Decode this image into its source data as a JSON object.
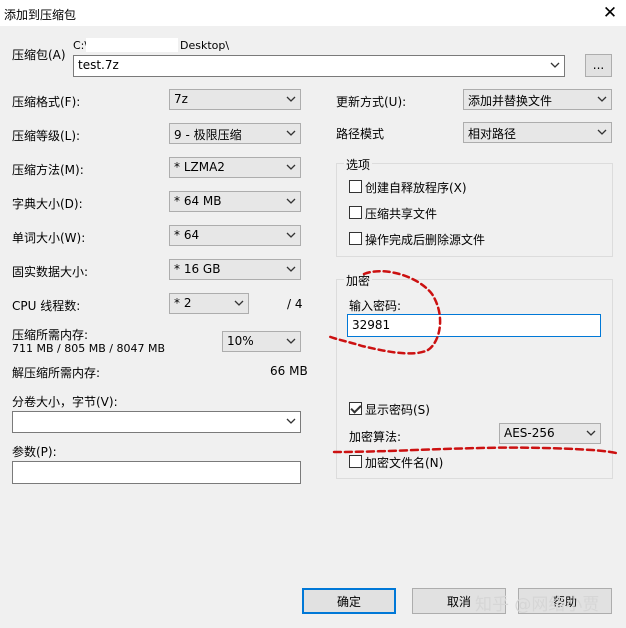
{
  "window": {
    "title": "添加到压缩包",
    "close_glyph": "✕"
  },
  "archive": {
    "label": "压缩包(A)",
    "path_prefix": "C:\\",
    "path_suffix": "Desktop\\",
    "filename": "test.7z",
    "browse_label": "..."
  },
  "left": {
    "format": {
      "label": "压缩格式(F):",
      "value": "7z"
    },
    "level": {
      "label": "压缩等级(L):",
      "value": "9 - 极限压缩"
    },
    "method": {
      "label": "压缩方法(M):",
      "value": "* LZMA2"
    },
    "dict": {
      "label": "字典大小(D):",
      "value": "* 64 MB"
    },
    "word": {
      "label": "单词大小(W):",
      "value": "* 64"
    },
    "solid": {
      "label": "固实数据大小:",
      "value": "* 16 GB"
    },
    "threads": {
      "label": "CPU 线程数:",
      "value": "* 2",
      "max": "/ 4"
    },
    "mem_compress": {
      "label": "压缩所需内存:",
      "detail": "711 MB / 805 MB / 8047 MB",
      "percent": "10%"
    },
    "mem_decompress": {
      "label": "解压缩所需内存:",
      "value": "66 MB"
    },
    "volume": {
      "label": "分卷大小，字节(V):",
      "value": ""
    },
    "params": {
      "label": "参数(P):",
      "value": ""
    }
  },
  "right": {
    "update": {
      "label": "更新方式(U):",
      "value": "添加并替换文件"
    },
    "pathmode": {
      "label": "路径模式",
      "value": "相对路径"
    },
    "options": {
      "title": "选项",
      "items": [
        {
          "label": "创建自释放程序(X)",
          "checked": false
        },
        {
          "label": "压缩共享文件",
          "checked": false
        },
        {
          "label": "操作完成后删除源文件",
          "checked": false
        }
      ]
    },
    "encryption": {
      "title": "加密",
      "password_label": "输入密码:",
      "password": "32981",
      "show_password": {
        "label": "显示密码(S)",
        "checked": true
      },
      "algo_label": "加密算法:",
      "algo_value": "AES-256",
      "encrypt_names": {
        "label": "加密文件名(N)",
        "checked": false
      }
    }
  },
  "buttons": {
    "ok": "确定",
    "cancel": "取消",
    "help": "帮助"
  },
  "watermark": "知乎 @网络小贾",
  "colors": {
    "annotation": "#cc1111",
    "accent": "#0078d7"
  }
}
